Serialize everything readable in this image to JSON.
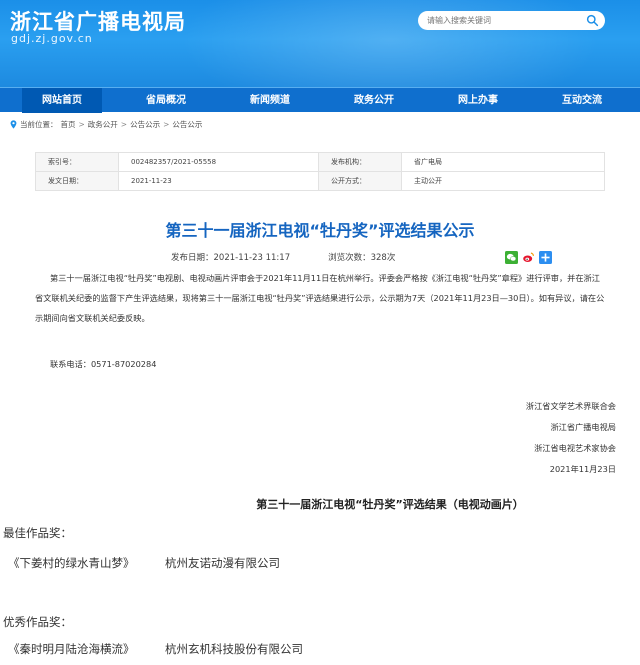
{
  "header": {
    "site_title": "浙江省广播电视局",
    "domain": "gdj.zj.gov.cn",
    "search_placeholder": "请输入搜索关键词"
  },
  "nav": {
    "items": [
      "网站首页",
      "省局概况",
      "新闻频道",
      "政务公开",
      "网上办事",
      "互动交流"
    ],
    "active_index": 0
  },
  "breadcrumb": {
    "prefix": "当前位置：",
    "items": [
      "首页",
      "政务公开",
      "公告公示",
      "公告公示"
    ]
  },
  "meta": {
    "index_label": "索引号：",
    "index_value": "002482357/2021-05558",
    "org_label": "发布机构：",
    "org_value": "省广电局",
    "date_label": "发文日期：",
    "date_value": "2021-11-23",
    "method_label": "公开方式：",
    "method_value": "主动公开"
  },
  "article": {
    "title": "第三十一届浙江电视“牡丹奖”评选结果公示",
    "publish_date": "发布日期：2021-11-23 11:17",
    "views": "浏览次数：328次",
    "body": "第三十一届浙江电视“牡丹奖”电视剧、电视动画片评审会于2021年11月11日在杭州举行。评委会严格按《浙江电视“牡丹奖”章程》进行评审，并在浙江省文联机关纪委的监督下产生评选结果，现将第三十一届浙江电视“牡丹奖”评选结果进行公示，公示期为7天（2021年11月23日—30日）。如有异议，请在公示期间向省文联机关纪委反映。",
    "contact": "联系电话：0571-87020284",
    "signatures": [
      "浙江省文学艺术界联合会",
      "浙江省广播电视局",
      "浙江省电视艺术家协会",
      "2021年11月23日"
    ]
  },
  "results": {
    "title": "第三十一届浙江电视“牡丹奖”评选结果（电视动画片）",
    "best_label": "最佳作品奖：",
    "best_work": "《下姜村的绿水青山梦》",
    "best_company": "杭州友诺动漫有限公司",
    "excellent_label": "优秀作品奖：",
    "excellent_work": "《秦时明月陆沧海横流》",
    "excellent_company": "杭州玄机科技股份有限公司"
  },
  "colors": {
    "header_blue": "#1b8fe8",
    "nav_blue": "#0f6fce",
    "title_blue": "#1565c0"
  },
  "icons": [
    "search-icon",
    "location-icon",
    "wechat-icon",
    "weibo-icon",
    "plus-share-icon"
  ]
}
